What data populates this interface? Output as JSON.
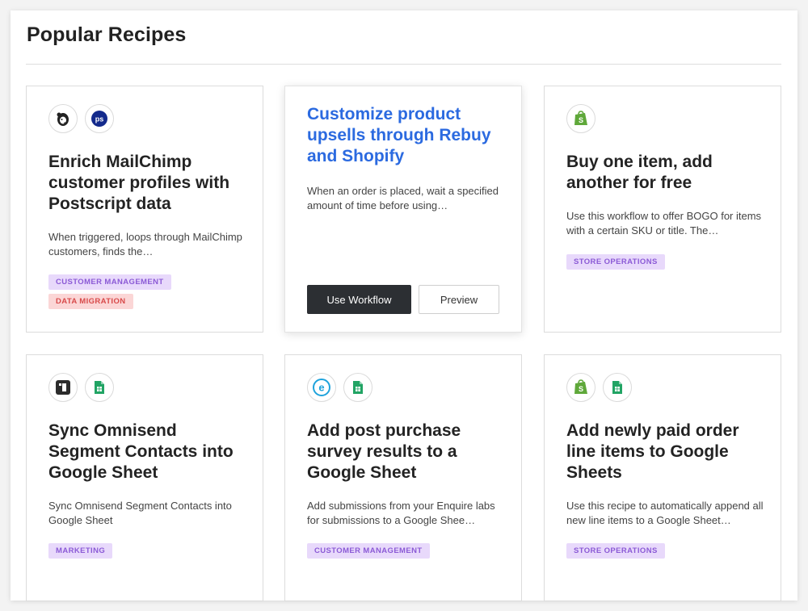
{
  "panel": {
    "title": "Popular Recipes"
  },
  "cards": [
    {
      "icons": [
        "mailchimp-icon",
        "postscript-icon"
      ],
      "title": "Enrich MailChimp customer profiles with Postscript data",
      "description": "When triggered, loops through MailChimp customers, finds the…",
      "tags": [
        {
          "label": "Customer Management",
          "color": "purple"
        },
        {
          "label": "Data Migration",
          "color": "red"
        }
      ]
    },
    {
      "icons": [],
      "title": "Customize product upsells through Rebuy and Shopify",
      "description": "When an order is placed, wait a specified amount of time before using…",
      "tags": [],
      "buttons": {
        "use_label": "Use Workflow",
        "preview_label": "Preview"
      }
    },
    {
      "icons": [
        "shopify-icon"
      ],
      "title": "Buy one item, add another for free",
      "description": "Use this workflow to offer BOGO for items with a certain SKU or title. The…",
      "tags": [
        {
          "label": "Store Operations",
          "color": "purple"
        }
      ]
    },
    {
      "icons": [
        "omnisend-icon",
        "google-sheets-icon"
      ],
      "title": "Sync Omnisend Segment Contacts into Google Sheet",
      "description": "Sync Omnisend Segment Contacts into Google Sheet",
      "tags": [
        {
          "label": "Marketing",
          "color": "purple"
        }
      ]
    },
    {
      "icons": [
        "enquire-icon",
        "google-sheets-icon"
      ],
      "title": "Add post purchase survey results to a Google Sheet",
      "description": "Add submissions from your Enquire labs for submissions to a Google Shee…",
      "tags": [
        {
          "label": "Customer Management",
          "color": "purple"
        }
      ]
    },
    {
      "icons": [
        "shopify-icon",
        "google-sheets-icon"
      ],
      "title": "Add newly paid order line items to Google Sheets",
      "description": "Use this recipe to automatically append all new line items to a Google Sheet…",
      "tags": [
        {
          "label": "Store Operations",
          "color": "purple"
        }
      ]
    }
  ],
  "colors": {
    "hover_title": "#2b6ae0",
    "tag_purple_bg": "#e8d9fb",
    "tag_purple_text": "#8b5ad6",
    "tag_red_bg": "#fbd6d6",
    "tag_red_text": "#d84a4a",
    "primary_button": "#2c2f33"
  }
}
